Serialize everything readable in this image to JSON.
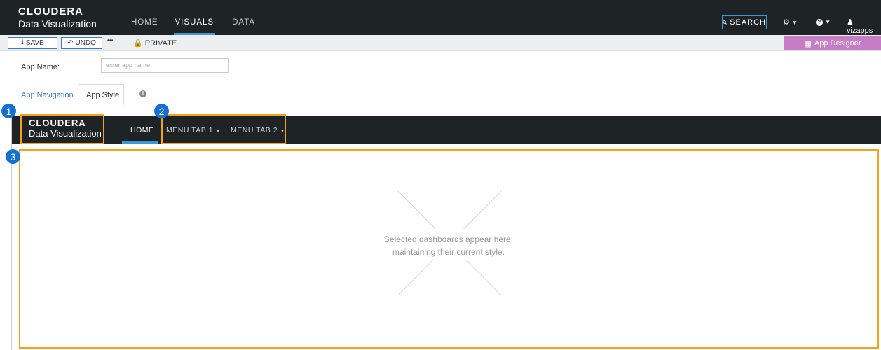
{
  "app": {
    "brand": "CLOUDERA",
    "subtitle": "Data Visualization"
  },
  "topnav": {
    "items": [
      "HOME",
      "VISUALS",
      "DATA"
    ],
    "active": "VISUALS",
    "search_label": "SEARCH",
    "user": "vizapps"
  },
  "toolbar": {
    "save_label": "SAVE",
    "undo_label": "UNDO",
    "more_label": "•••",
    "private_label": "PRIVATE",
    "app_designer_label": "App Designer"
  },
  "form": {
    "app_name_label": "App Name:",
    "app_name_placeholder": "enter app name",
    "app_name_value": ""
  },
  "tabs": {
    "nav_label": "App Navigation",
    "style_label": "App Style",
    "active": "App Style"
  },
  "preview": {
    "logo_brand": "CLOUDERA",
    "logo_subtitle": "Data Visualization",
    "menu_home": "HOME",
    "menu_tab1": "MENU TAB 1",
    "menu_tab2": "MENU TAB 2",
    "placeholder_line1": "Selected dashboards appear here,",
    "placeholder_line2": "maintaining their current style."
  },
  "callouts": [
    "1",
    "2",
    "3"
  ],
  "colors": {
    "topbar": "#1e2326",
    "accent": "#3a9ad9",
    "highlight": "#f4a11c",
    "callout": "#1570d6",
    "app_designer": "#c67dc6"
  }
}
